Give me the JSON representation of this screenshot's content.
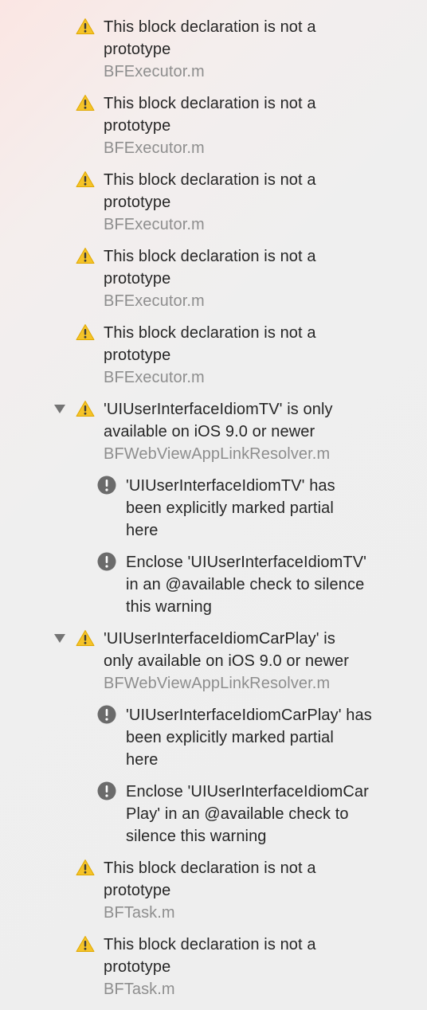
{
  "icons": {
    "warning": "warning-triangle-icon",
    "note": "exclamation-circle-icon",
    "disclosure": "disclosure-triangle-down-icon"
  },
  "colors": {
    "warning_fill": "#f5c328",
    "warning_glyph": "#3b3b3b",
    "note_fill": "#6b6b6b",
    "secondary_text": "#8e8e8e"
  },
  "issues": [
    {
      "message": "This block declaration is not a\nprototype",
      "file": "BFExecutor.m"
    },
    {
      "message": "This block declaration is not a\nprototype",
      "file": "BFExecutor.m"
    },
    {
      "message": "This block declaration is not a\nprototype",
      "file": "BFExecutor.m"
    },
    {
      "message": "This block declaration is not a\nprototype",
      "file": "BFExecutor.m"
    },
    {
      "message": "This block declaration is not a\nprototype",
      "file": "BFExecutor.m"
    },
    {
      "message": "'UIUserInterfaceIdiomTV' is only\navailable on iOS 9.0 or newer",
      "file": "BFWebViewAppLinkResolver.m",
      "expanded": true,
      "notes": [
        {
          "message": "'UIUserInterfaceIdiomTV' has\nbeen explicitly marked partial\nhere"
        },
        {
          "message": "Enclose 'UIUserInterfaceIdiomTV'\nin an @available check to silence\nthis warning"
        }
      ]
    },
    {
      "message": "'UIUserInterfaceIdiomCarPlay' is\nonly available on iOS 9.0 or newer",
      "file": "BFWebViewAppLinkResolver.m",
      "expanded": true,
      "notes": [
        {
          "message": "'UIUserInterfaceIdiomCarPlay' has\nbeen explicitly marked partial\nhere"
        },
        {
          "message": "Enclose 'UIUserInterfaceIdiomCar\nPlay' in an @available check to\nsilence this warning"
        }
      ]
    },
    {
      "message": "This block declaration is not a\nprototype",
      "file": "BFTask.m"
    },
    {
      "message": "This block declaration is not a\nprototype",
      "file": "BFTask.m"
    }
  ]
}
